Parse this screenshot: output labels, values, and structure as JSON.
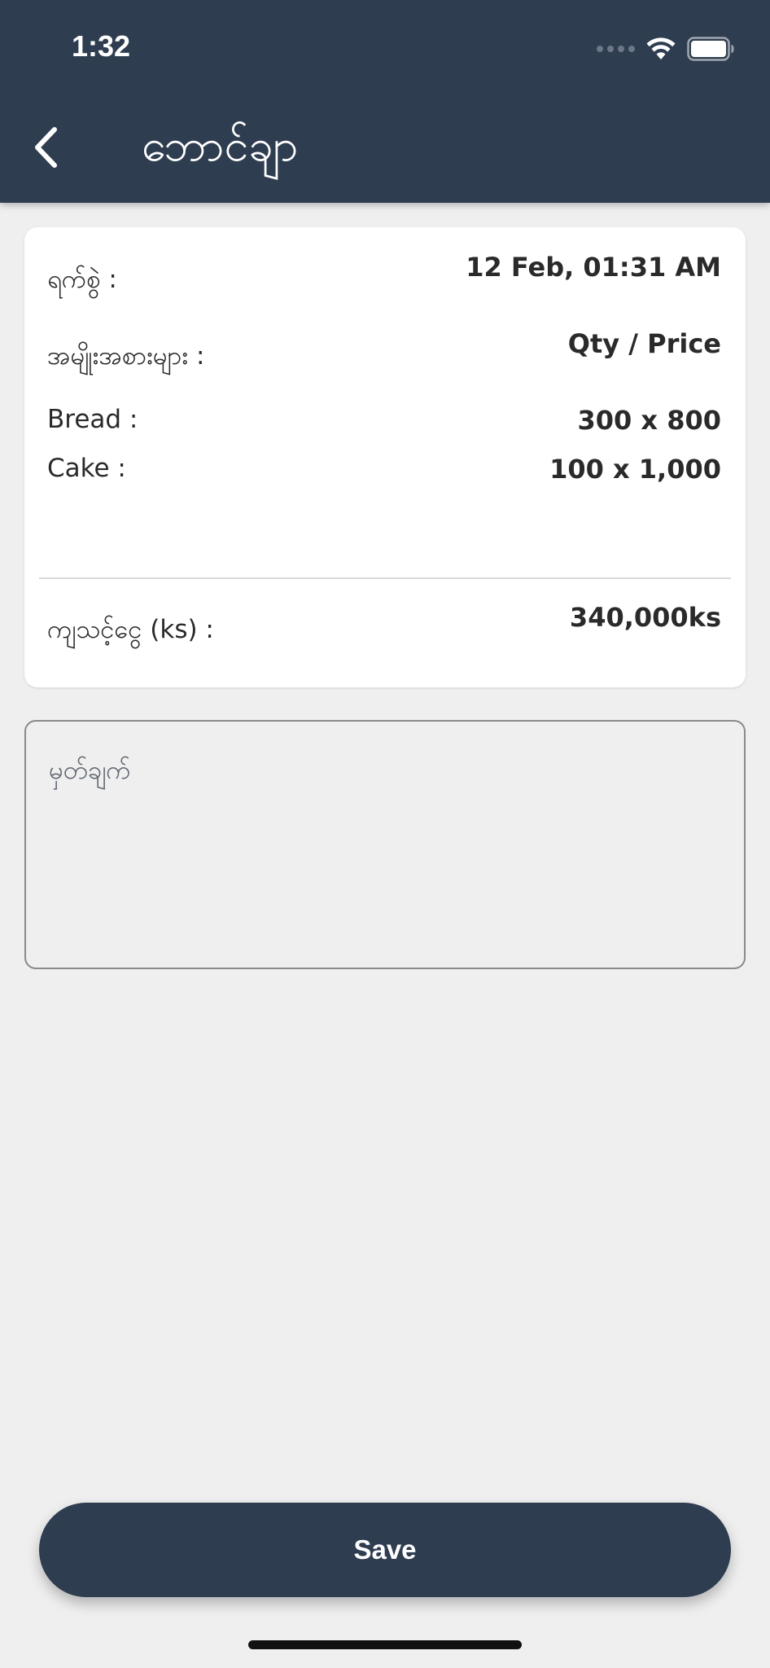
{
  "status_bar": {
    "time": "1:32",
    "icons": [
      "cellular-signal-icon",
      "wifi-icon",
      "battery-icon"
    ]
  },
  "header": {
    "title": "ဘောင်ချာ",
    "back_icon": "chevron-left-icon"
  },
  "voucher": {
    "date_label": "ရက်စွဲ :",
    "date_value": "12 Feb, 01:31 AM",
    "items_label": "အမျိုးအစားများ :",
    "items_header": "Qty / Price",
    "items": [
      {
        "name": "Bread :",
        "qty_price": "300 x 800"
      },
      {
        "name": "Cake :",
        "qty_price": "100 x 1,000"
      }
    ],
    "total_label": "ကျသင့်ငွေ (ks) :",
    "total_value": "340,000ks"
  },
  "note": {
    "placeholder": "မှတ်ချက်",
    "value": ""
  },
  "actions": {
    "save_label": "Save"
  },
  "colors": {
    "header_bg": "#2e3d50",
    "page_bg": "#efefef",
    "card_bg": "#ffffff",
    "button_bg": "#2e3d50"
  }
}
